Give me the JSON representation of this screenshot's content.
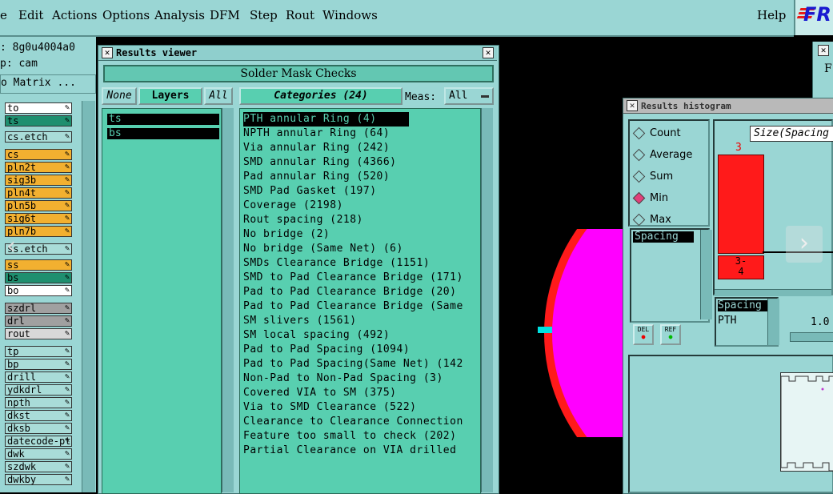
{
  "menubar": {
    "items": [
      "e",
      "Edit",
      "Actions",
      "Options",
      "Analysis",
      "DFM",
      "Step",
      "Rout",
      "Windows"
    ],
    "help": "Help",
    "logo": "FR"
  },
  "left_panel": {
    "job_line": ":  8g0u4004a0",
    "step_line": "p: cam",
    "matrix_button": "o Matrix ...",
    "layers": [
      {
        "name": "to",
        "color": "#ffffff"
      },
      {
        "name": "ts",
        "color": "#1f8f6f"
      },
      {
        "name": "cs.etch",
        "color": "#a9dcd8"
      },
      {
        "name": "cs",
        "color": "#f2b030"
      },
      {
        "name": "pln2t",
        "color": "#f2b030"
      },
      {
        "name": "sig3b",
        "color": "#f2b030"
      },
      {
        "name": "pln4t",
        "color": "#f2b030"
      },
      {
        "name": "pln5b",
        "color": "#f2b030"
      },
      {
        "name": "sig6t",
        "color": "#f2b030"
      },
      {
        "name": "pln7b",
        "color": "#f2b030"
      },
      {
        "name": "ss.etch",
        "color": "#a9dcd8"
      },
      {
        "name": "ss",
        "color": "#f2b030"
      },
      {
        "name": "bs",
        "color": "#1f8f6f"
      },
      {
        "name": "bo",
        "color": "#ffffff"
      },
      {
        "name": "szdrl",
        "color": "#a0a0a0"
      },
      {
        "name": "drl",
        "color": "#a0a0a0"
      },
      {
        "name": "rout",
        "color": "#d8d8d8"
      },
      {
        "name": "tp",
        "color": "#a9dcd8"
      },
      {
        "name": "bp",
        "color": "#a9dcd8"
      },
      {
        "name": "drill",
        "color": "#a9dcd8"
      },
      {
        "name": "ydkdrl",
        "color": "#a9dcd8"
      },
      {
        "name": "npth",
        "color": "#a9dcd8"
      },
      {
        "name": "dkst",
        "color": "#a9dcd8"
      },
      {
        "name": "dksb",
        "color": "#a9dcd8"
      },
      {
        "name": "datecode-pt",
        "color": "#a9dcd8"
      },
      {
        "name": "dwk",
        "color": "#a9dcd8"
      },
      {
        "name": "szdwk",
        "color": "#a9dcd8"
      },
      {
        "name": "dwkby",
        "color": "#a9dcd8"
      }
    ]
  },
  "results_viewer": {
    "title": "Results viewer",
    "header": "Solder Mask Checks",
    "none_btn": "None",
    "layers_btn": "Layers",
    "all_btn": "All",
    "categories_btn": "Categories (24)",
    "meas_label": "Meas:",
    "meas_value": "All",
    "layers": [
      "ts",
      "bs"
    ],
    "categories": [
      "PTH annular Ring (4)",
      "NPTH annular Ring (64)",
      "Via annular Ring (242)",
      "SMD annular Ring (4366)",
      "Pad annular Ring (520)",
      "SMD Pad Gasket (197)",
      "Coverage (2198)",
      "Rout spacing (218)",
      "No bridge (2)",
      "No bridge (Same Net) (6)",
      "SMDs Clearance Bridge (1151)",
      "SMD to Pad Clearance Bridge (171)",
      "Pad to Pad Clearance Bridge (20)",
      "Pad to Pad Clearance Bridge (Same",
      "SM slivers (1561)",
      "SM local spacing (492)",
      "Pad to Pad Spacing (1094)",
      "Pad to Pad Spacing(Same Net) (142",
      "Non-Pad to Non-Pad Spacing (3)",
      "Covered VIA to SM (375)",
      "Via to SMD Clearance (522)",
      "Clearance to Clearance Connection",
      "Feature too small to check (202)",
      "Partial Clearance on VIA drilled"
    ]
  },
  "histogram": {
    "title": "Results histogram",
    "stats": [
      "Count",
      "Average",
      "Sum",
      "Min",
      "Max"
    ],
    "selected_stat": "Min",
    "size_label": "Size(Spacing",
    "bar_value": "3",
    "bar_range": "3-\n4",
    "measure_list": [
      "Spacing"
    ],
    "selected_measure": "Spacing",
    "type_list": [
      "Spacing",
      "PTH"
    ],
    "scale_value": "1.0",
    "del_btn": "DEL",
    "ref_btn": "REF"
  },
  "right_window": {
    "letter": "F"
  }
}
